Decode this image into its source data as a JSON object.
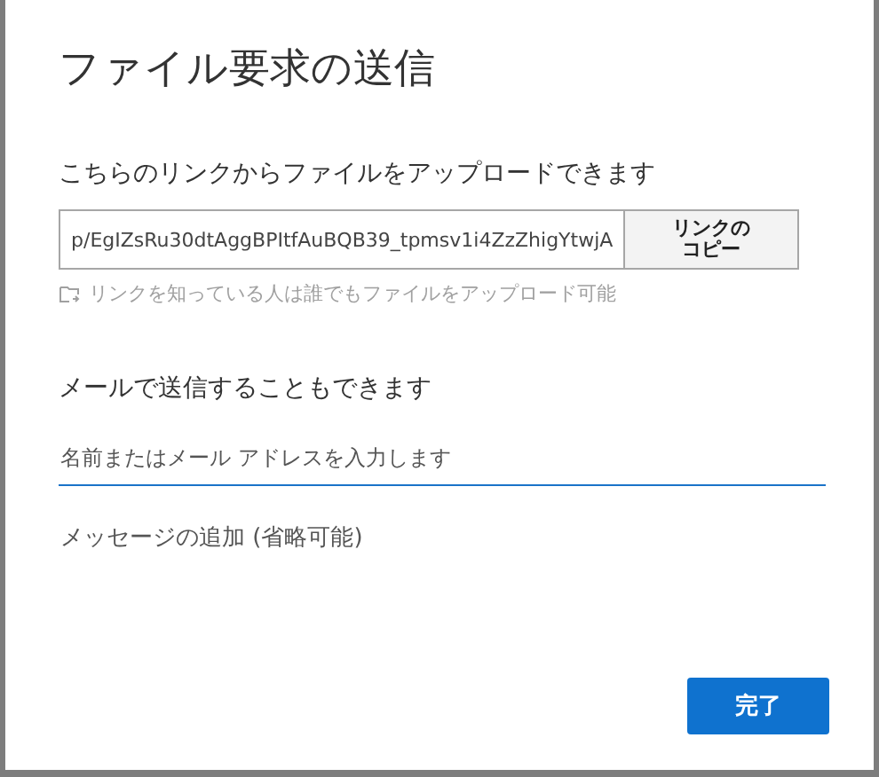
{
  "dialog": {
    "title": "ファイル要求の送信",
    "link_section": {
      "label": "こちらのリンクからファイルをアップロードできます",
      "link": "p/EgIZsRu30dtAggBPItfAuBQB39_tpmsv1i4ZzZhigYtwjA",
      "copy_button": "リンクのコピー",
      "hint": "リンクを知っている人は誰でもファイルをアップロード可能"
    },
    "email_section": {
      "label": "メールで送信することもできます",
      "recipient": {
        "placeholder": "名前またはメール アドレスを入力します"
      },
      "message": {
        "placeholder": "メッセージの追加 (省略可能)"
      }
    },
    "buttons": [
      {
        "label": "完了",
        "kind": "primary"
      }
    ]
  }
}
